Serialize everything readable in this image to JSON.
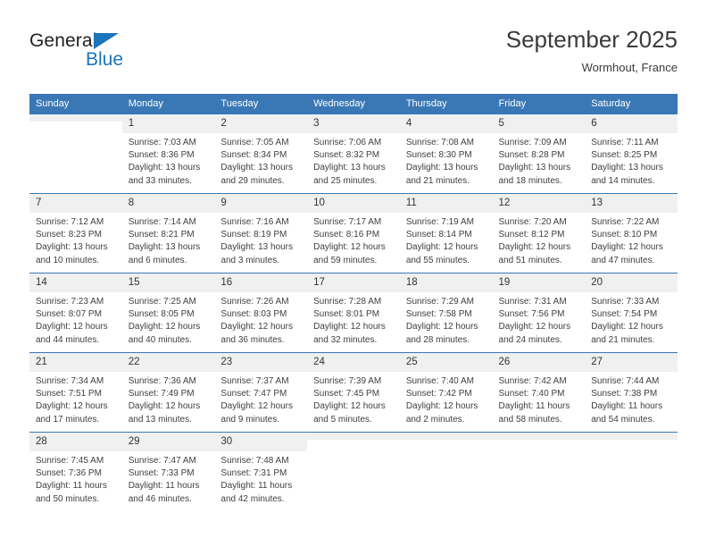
{
  "brand": {
    "name_dark": "General",
    "name_blue": "Blue",
    "accent_color": "#1b75bb",
    "header_color": "#3a78b5"
  },
  "header": {
    "title": "September 2025",
    "location": "Wormhout, France"
  },
  "weekdays": [
    "Sunday",
    "Monday",
    "Tuesday",
    "Wednesday",
    "Thursday",
    "Friday",
    "Saturday"
  ],
  "labels": {
    "sunrise_prefix": "Sunrise:",
    "sunset_prefix": "Sunset:",
    "daylight_prefix": "Daylight:"
  },
  "weeks": [
    [
      {
        "day": "",
        "sunrise": "",
        "sunset": "",
        "daylight_1": "",
        "daylight_2": ""
      },
      {
        "day": "1",
        "sunrise": "Sunrise: 7:03 AM",
        "sunset": "Sunset: 8:36 PM",
        "daylight_1": "Daylight: 13 hours",
        "daylight_2": "and 33 minutes."
      },
      {
        "day": "2",
        "sunrise": "Sunrise: 7:05 AM",
        "sunset": "Sunset: 8:34 PM",
        "daylight_1": "Daylight: 13 hours",
        "daylight_2": "and 29 minutes."
      },
      {
        "day": "3",
        "sunrise": "Sunrise: 7:06 AM",
        "sunset": "Sunset: 8:32 PM",
        "daylight_1": "Daylight: 13 hours",
        "daylight_2": "and 25 minutes."
      },
      {
        "day": "4",
        "sunrise": "Sunrise: 7:08 AM",
        "sunset": "Sunset: 8:30 PM",
        "daylight_1": "Daylight: 13 hours",
        "daylight_2": "and 21 minutes."
      },
      {
        "day": "5",
        "sunrise": "Sunrise: 7:09 AM",
        "sunset": "Sunset: 8:28 PM",
        "daylight_1": "Daylight: 13 hours",
        "daylight_2": "and 18 minutes."
      },
      {
        "day": "6",
        "sunrise": "Sunrise: 7:11 AM",
        "sunset": "Sunset: 8:25 PM",
        "daylight_1": "Daylight: 13 hours",
        "daylight_2": "and 14 minutes."
      }
    ],
    [
      {
        "day": "7",
        "sunrise": "Sunrise: 7:12 AM",
        "sunset": "Sunset: 8:23 PM",
        "daylight_1": "Daylight: 13 hours",
        "daylight_2": "and 10 minutes."
      },
      {
        "day": "8",
        "sunrise": "Sunrise: 7:14 AM",
        "sunset": "Sunset: 8:21 PM",
        "daylight_1": "Daylight: 13 hours",
        "daylight_2": "and 6 minutes."
      },
      {
        "day": "9",
        "sunrise": "Sunrise: 7:16 AM",
        "sunset": "Sunset: 8:19 PM",
        "daylight_1": "Daylight: 13 hours",
        "daylight_2": "and 3 minutes."
      },
      {
        "day": "10",
        "sunrise": "Sunrise: 7:17 AM",
        "sunset": "Sunset: 8:16 PM",
        "daylight_1": "Daylight: 12 hours",
        "daylight_2": "and 59 minutes."
      },
      {
        "day": "11",
        "sunrise": "Sunrise: 7:19 AM",
        "sunset": "Sunset: 8:14 PM",
        "daylight_1": "Daylight: 12 hours",
        "daylight_2": "and 55 minutes."
      },
      {
        "day": "12",
        "sunrise": "Sunrise: 7:20 AM",
        "sunset": "Sunset: 8:12 PM",
        "daylight_1": "Daylight: 12 hours",
        "daylight_2": "and 51 minutes."
      },
      {
        "day": "13",
        "sunrise": "Sunrise: 7:22 AM",
        "sunset": "Sunset: 8:10 PM",
        "daylight_1": "Daylight: 12 hours",
        "daylight_2": "and 47 minutes."
      }
    ],
    [
      {
        "day": "14",
        "sunrise": "Sunrise: 7:23 AM",
        "sunset": "Sunset: 8:07 PM",
        "daylight_1": "Daylight: 12 hours",
        "daylight_2": "and 44 minutes."
      },
      {
        "day": "15",
        "sunrise": "Sunrise: 7:25 AM",
        "sunset": "Sunset: 8:05 PM",
        "daylight_1": "Daylight: 12 hours",
        "daylight_2": "and 40 minutes."
      },
      {
        "day": "16",
        "sunrise": "Sunrise: 7:26 AM",
        "sunset": "Sunset: 8:03 PM",
        "daylight_1": "Daylight: 12 hours",
        "daylight_2": "and 36 minutes."
      },
      {
        "day": "17",
        "sunrise": "Sunrise: 7:28 AM",
        "sunset": "Sunset: 8:01 PM",
        "daylight_1": "Daylight: 12 hours",
        "daylight_2": "and 32 minutes."
      },
      {
        "day": "18",
        "sunrise": "Sunrise: 7:29 AM",
        "sunset": "Sunset: 7:58 PM",
        "daylight_1": "Daylight: 12 hours",
        "daylight_2": "and 28 minutes."
      },
      {
        "day": "19",
        "sunrise": "Sunrise: 7:31 AM",
        "sunset": "Sunset: 7:56 PM",
        "daylight_1": "Daylight: 12 hours",
        "daylight_2": "and 24 minutes."
      },
      {
        "day": "20",
        "sunrise": "Sunrise: 7:33 AM",
        "sunset": "Sunset: 7:54 PM",
        "daylight_1": "Daylight: 12 hours",
        "daylight_2": "and 21 minutes."
      }
    ],
    [
      {
        "day": "21",
        "sunrise": "Sunrise: 7:34 AM",
        "sunset": "Sunset: 7:51 PM",
        "daylight_1": "Daylight: 12 hours",
        "daylight_2": "and 17 minutes."
      },
      {
        "day": "22",
        "sunrise": "Sunrise: 7:36 AM",
        "sunset": "Sunset: 7:49 PM",
        "daylight_1": "Daylight: 12 hours",
        "daylight_2": "and 13 minutes."
      },
      {
        "day": "23",
        "sunrise": "Sunrise: 7:37 AM",
        "sunset": "Sunset: 7:47 PM",
        "daylight_1": "Daylight: 12 hours",
        "daylight_2": "and 9 minutes."
      },
      {
        "day": "24",
        "sunrise": "Sunrise: 7:39 AM",
        "sunset": "Sunset: 7:45 PM",
        "daylight_1": "Daylight: 12 hours",
        "daylight_2": "and 5 minutes."
      },
      {
        "day": "25",
        "sunrise": "Sunrise: 7:40 AM",
        "sunset": "Sunset: 7:42 PM",
        "daylight_1": "Daylight: 12 hours",
        "daylight_2": "and 2 minutes."
      },
      {
        "day": "26",
        "sunrise": "Sunrise: 7:42 AM",
        "sunset": "Sunset: 7:40 PM",
        "daylight_1": "Daylight: 11 hours",
        "daylight_2": "and 58 minutes."
      },
      {
        "day": "27",
        "sunrise": "Sunrise: 7:44 AM",
        "sunset": "Sunset: 7:38 PM",
        "daylight_1": "Daylight: 11 hours",
        "daylight_2": "and 54 minutes."
      }
    ],
    [
      {
        "day": "28",
        "sunrise": "Sunrise: 7:45 AM",
        "sunset": "Sunset: 7:36 PM",
        "daylight_1": "Daylight: 11 hours",
        "daylight_2": "and 50 minutes."
      },
      {
        "day": "29",
        "sunrise": "Sunrise: 7:47 AM",
        "sunset": "Sunset: 7:33 PM",
        "daylight_1": "Daylight: 11 hours",
        "daylight_2": "and 46 minutes."
      },
      {
        "day": "30",
        "sunrise": "Sunrise: 7:48 AM",
        "sunset": "Sunset: 7:31 PM",
        "daylight_1": "Daylight: 11 hours",
        "daylight_2": "and 42 minutes."
      },
      {
        "day": "",
        "sunrise": "",
        "sunset": "",
        "daylight_1": "",
        "daylight_2": ""
      },
      {
        "day": "",
        "sunrise": "",
        "sunset": "",
        "daylight_1": "",
        "daylight_2": ""
      },
      {
        "day": "",
        "sunrise": "",
        "sunset": "",
        "daylight_1": "",
        "daylight_2": ""
      },
      {
        "day": "",
        "sunrise": "",
        "sunset": "",
        "daylight_1": "",
        "daylight_2": ""
      }
    ]
  ]
}
